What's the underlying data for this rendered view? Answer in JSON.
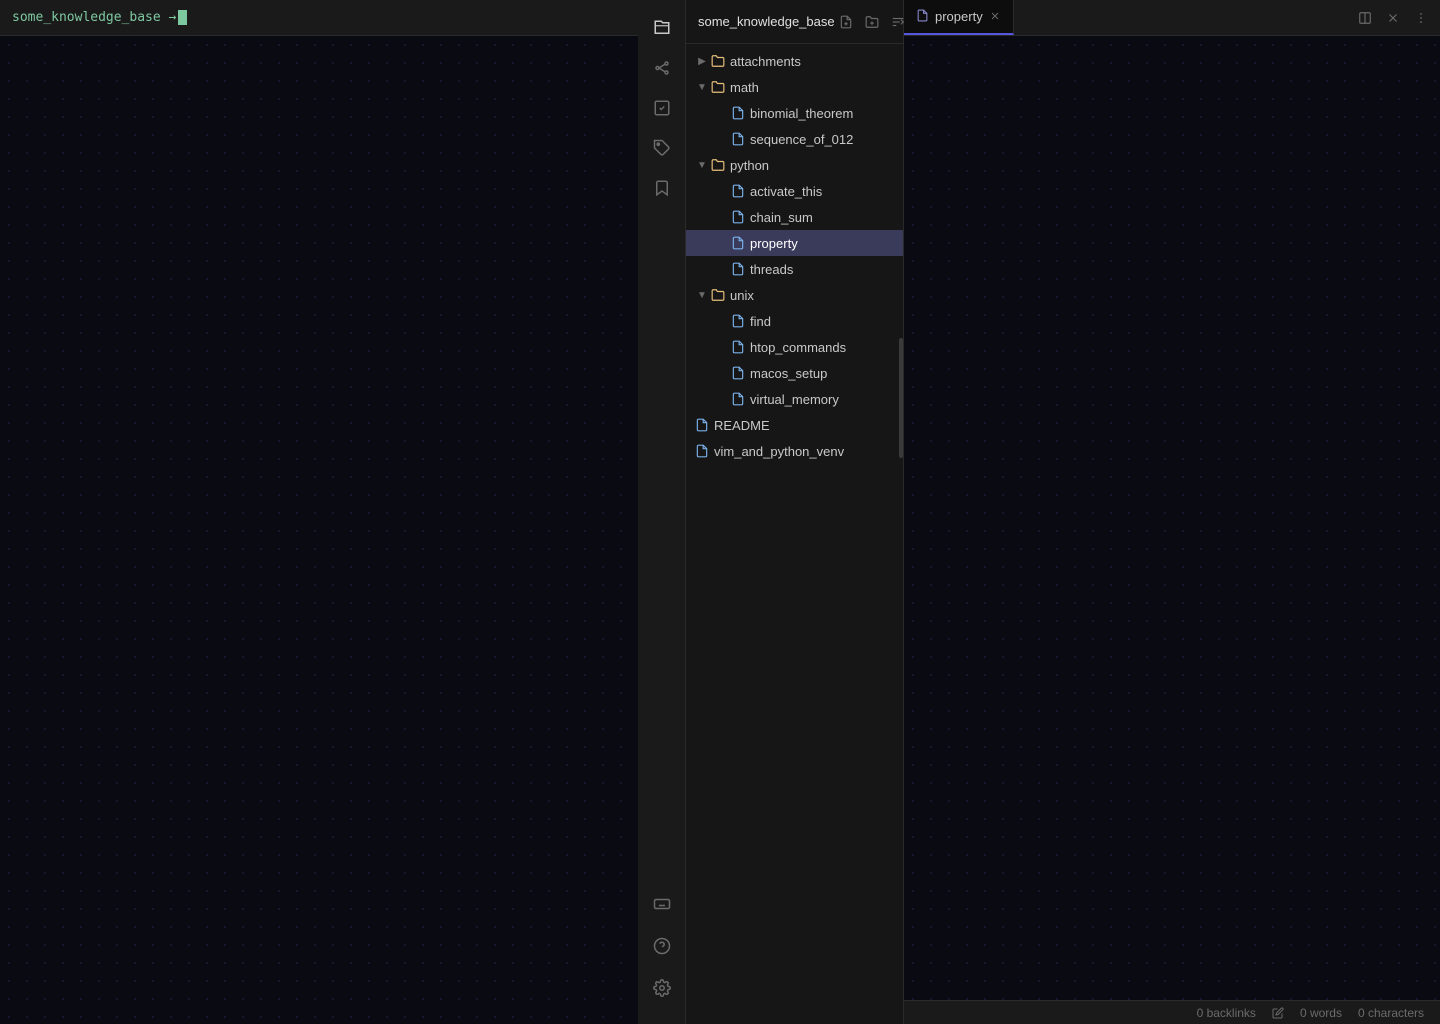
{
  "terminal": {
    "title": "some_knowledge_base",
    "prompt": "→"
  },
  "activity_bar": {
    "icons": [
      {
        "id": "files",
        "symbol": "⎘",
        "tooltip": "Files"
      },
      {
        "id": "search",
        "symbol": "⚙",
        "tooltip": "Graph"
      },
      {
        "id": "calendar",
        "symbol": "☑",
        "tooltip": "Tasks"
      },
      {
        "id": "tags",
        "symbol": "⊞",
        "tooltip": "Tags"
      },
      {
        "id": "bookmarks",
        "symbol": "≡",
        "tooltip": "Bookmarks"
      }
    ],
    "bottom_icons": [
      {
        "id": "help2",
        "symbol": "⌨",
        "tooltip": "Keyboard shortcuts"
      },
      {
        "id": "help",
        "symbol": "?",
        "tooltip": "Help"
      },
      {
        "id": "settings",
        "symbol": "⚙",
        "tooltip": "Settings"
      }
    ]
  },
  "sidebar": {
    "vault_name": "some_knowledge_base",
    "new_note_label": "New note",
    "new_folder_label": "New folder",
    "sort_label": "Sort",
    "tree": [
      {
        "id": "attachments",
        "label": "attachments",
        "type": "folder",
        "indent": 0,
        "collapsed": true
      },
      {
        "id": "math",
        "label": "math",
        "type": "folder",
        "indent": 0,
        "collapsed": false
      },
      {
        "id": "binomial_theorem",
        "label": "binomial_theorem",
        "type": "file",
        "indent": 2
      },
      {
        "id": "sequence_of_012",
        "label": "sequence_of_012",
        "type": "file",
        "indent": 2
      },
      {
        "id": "python",
        "label": "python",
        "type": "folder",
        "indent": 0,
        "collapsed": false
      },
      {
        "id": "activate_this",
        "label": "activate_this",
        "type": "file",
        "indent": 2
      },
      {
        "id": "chain_sum",
        "label": "chain_sum",
        "type": "file",
        "indent": 2
      },
      {
        "id": "property",
        "label": "property",
        "type": "file",
        "indent": 2,
        "active": true
      },
      {
        "id": "threads",
        "label": "threads",
        "type": "file",
        "indent": 2
      },
      {
        "id": "unix",
        "label": "unix",
        "type": "folder",
        "indent": 0,
        "collapsed": false
      },
      {
        "id": "find",
        "label": "find",
        "type": "file",
        "indent": 2
      },
      {
        "id": "htop_commands",
        "label": "htop_commands",
        "type": "file",
        "indent": 2
      },
      {
        "id": "macos_setup",
        "label": "macos_setup",
        "type": "file",
        "indent": 2
      },
      {
        "id": "virtual_memory",
        "label": "virtual_memory",
        "type": "file",
        "indent": 2
      },
      {
        "id": "README",
        "label": "README",
        "type": "file",
        "indent": 0
      },
      {
        "id": "vim_and_python_venv",
        "label": "vim_and_python_venv",
        "type": "file",
        "indent": 0
      }
    ]
  },
  "editor": {
    "tab_title": "property",
    "tab_icon": "📄"
  },
  "status_bar": {
    "backlinks": "0 backlinks",
    "words": "0 words",
    "characters": "0 characters"
  }
}
